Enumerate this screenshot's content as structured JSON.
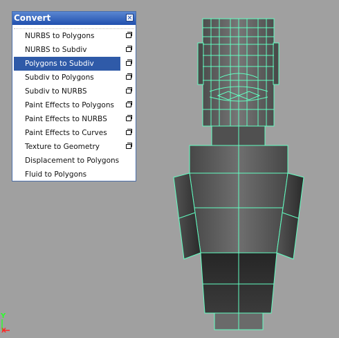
{
  "menu": {
    "title": "Convert",
    "items": [
      {
        "label": "NURBS to Polygons",
        "has_options": true,
        "selected": false
      },
      {
        "label": "NURBS to Subdiv",
        "has_options": true,
        "selected": false
      },
      {
        "label": "Polygons to Subdiv",
        "has_options": true,
        "selected": true
      },
      {
        "label": "Subdiv to Polygons",
        "has_options": true,
        "selected": false
      },
      {
        "label": "Subdiv to NURBS",
        "has_options": true,
        "selected": false
      },
      {
        "label": "Paint Effects to Polygons",
        "has_options": true,
        "selected": false
      },
      {
        "label": "Paint Effects to NURBS",
        "has_options": true,
        "selected": false
      },
      {
        "label": "Paint Effects to Curves",
        "has_options": true,
        "selected": false
      },
      {
        "label": "Texture to Geometry",
        "has_options": true,
        "selected": false
      },
      {
        "label": "Displacement to Polygons",
        "has_options": false,
        "selected": false
      },
      {
        "label": "Fluid to Polygons",
        "has_options": false,
        "selected": false
      }
    ]
  },
  "axis": {
    "y": "Y",
    "x": "X"
  },
  "colors": {
    "viewport_bg": "#a0a0a0",
    "wireframe": "#62ffc2",
    "menu_highlight": "#2f5aa8",
    "axis_y": "#2cff2c",
    "axis_x": "#ff2626"
  }
}
